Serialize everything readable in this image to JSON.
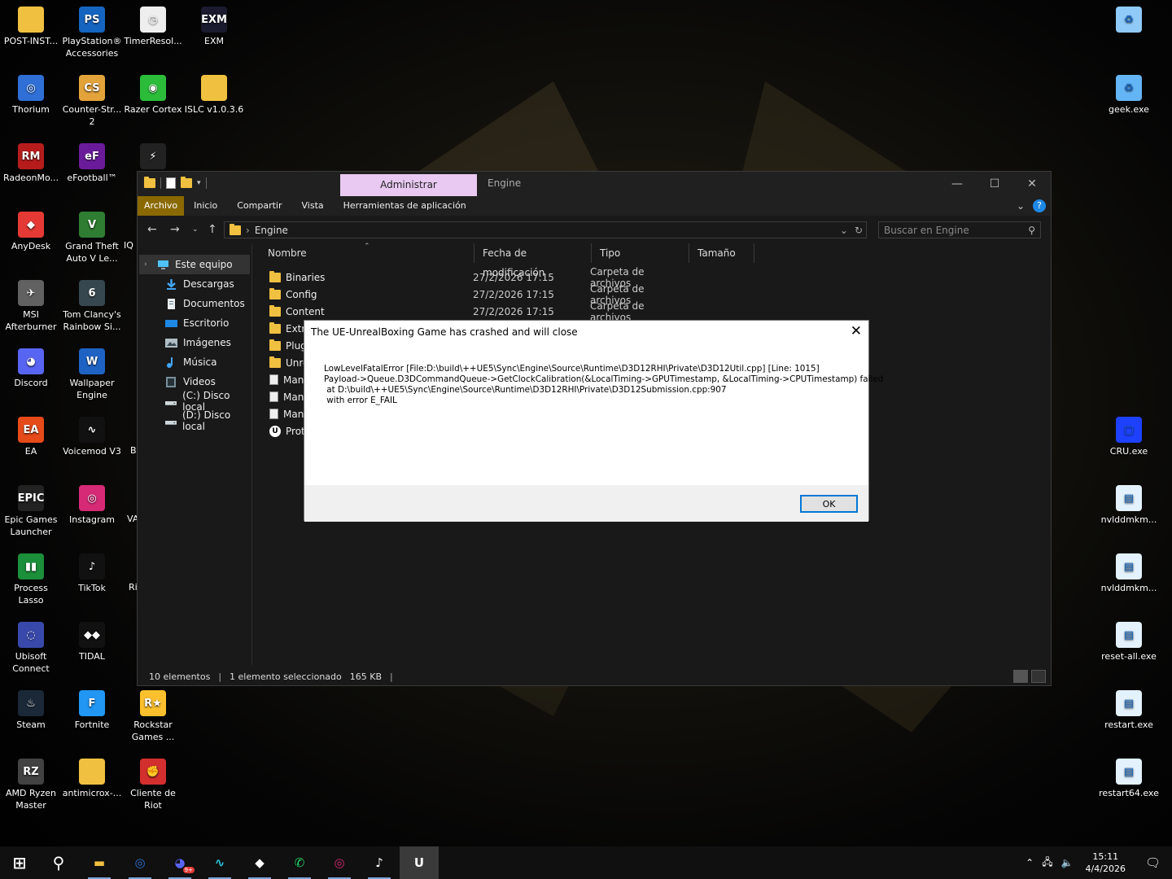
{
  "desktop": {
    "icons_left": [
      {
        "id": "post-install",
        "label": "POST-INST...",
        "glyph": "",
        "color": "#f0c040"
      },
      {
        "id": "playstation",
        "label": "PlayStation® Accessories",
        "glyph": "PS",
        "color": "#1565c0"
      },
      {
        "id": "timerresol",
        "label": "TimerResol...",
        "glyph": "◷",
        "color": "#eeeeee"
      },
      {
        "id": "exm",
        "label": "EXM",
        "glyph": "EXM",
        "color": "#1b1b2f"
      },
      {
        "id": "thorium",
        "label": "Thorium",
        "glyph": "◎",
        "color": "#2f6fd6"
      },
      {
        "id": "counter-strike",
        "label": "Counter-Str... 2",
        "glyph": "CS",
        "color": "#e3a33b"
      },
      {
        "id": "razer-cortex",
        "label": "Razer Cortex",
        "glyph": "◉",
        "color": "#2bbd3a"
      },
      {
        "id": "islc",
        "label": "ISLC v1.0.3.6",
        "glyph": "",
        "color": "#f0c040"
      },
      {
        "id": "radeon",
        "label": "RadeonMo...",
        "glyph": "RM",
        "color": "#b71c1c"
      },
      {
        "id": "efootball",
        "label": "eFootball™",
        "glyph": "eF",
        "color": "#6a1b9a"
      },
      {
        "id": "valorant-like",
        "label": "",
        "glyph": "⚡",
        "color": "#222222"
      },
      {
        "id": "anydesk",
        "label": "AnyDesk",
        "glyph": "◆",
        "color": "#e53935"
      },
      {
        "id": "gta",
        "label": "Grand Theft Auto V Le...",
        "glyph": "V",
        "color": "#2e7d32"
      },
      {
        "id": "msi-afterburner",
        "label": "MSI Afterburner",
        "glyph": "✈",
        "color": "#616161"
      },
      {
        "id": "rainbow-six",
        "label": "Tom Clancy's Rainbow Si...",
        "glyph": "6",
        "color": "#37474f"
      },
      {
        "id": "discord",
        "label": "Discord",
        "glyph": "◕",
        "color": "#5865f2"
      },
      {
        "id": "wallpaper-engine",
        "label": "Wallpaper Engine",
        "glyph": "W",
        "color": "#1e63c4"
      },
      {
        "id": "ea",
        "label": "EA",
        "glyph": "EA",
        "color": "#e64a19"
      },
      {
        "id": "voicemod",
        "label": "Voicemod V3",
        "glyph": "∿",
        "color": "#111111"
      },
      {
        "id": "epic-games",
        "label": "Epic Games Launcher",
        "glyph": "EPIC",
        "color": "#222222"
      },
      {
        "id": "instagram",
        "label": "Instagram",
        "glyph": "◎",
        "color": "#d62976"
      },
      {
        "id": "process-lasso",
        "label": "Process Lasso",
        "glyph": "▮▮",
        "color": "#1b8f3a"
      },
      {
        "id": "tiktok",
        "label": "TikTok",
        "glyph": "♪",
        "color": "#111111"
      },
      {
        "id": "ubisoft",
        "label": "Ubisoft Connect",
        "glyph": "◌",
        "color": "#3949ab"
      },
      {
        "id": "tidal",
        "label": "TIDAL",
        "glyph": "◆◆",
        "color": "#111111"
      },
      {
        "id": "steam",
        "label": "Steam",
        "glyph": "♨",
        "color": "#1b2838"
      },
      {
        "id": "fortnite",
        "label": "Fortnite",
        "glyph": "F",
        "color": "#2196f3"
      },
      {
        "id": "rockstar",
        "label": "Rockstar Games ...",
        "glyph": "R★",
        "color": "#fbc02d"
      },
      {
        "id": "ryzen-master",
        "label": "AMD Ryzen Master",
        "glyph": "RZ",
        "color": "#424242"
      },
      {
        "id": "antimicrox",
        "label": "antimicrox-...",
        "glyph": "",
        "color": "#f0c040"
      },
      {
        "id": "riot",
        "label": "Cliente de Riot",
        "glyph": "✊",
        "color": "#d32f2f"
      }
    ],
    "partial_labels": [
      {
        "id": "iq",
        "label": "IQ"
      },
      {
        "id": "b",
        "label": "B"
      },
      {
        "id": "va",
        "label": "VA"
      },
      {
        "id": "ri",
        "label": "Ri"
      }
    ],
    "icons_right": [
      {
        "id": "recycle-bin",
        "label": "",
        "glyph": "♻",
        "color": "#90caf9"
      },
      {
        "id": "geek",
        "label": "geek.exe",
        "glyph": "♻",
        "color": "#64b5f6"
      },
      {
        "id": "cru",
        "label": "CRU.exe",
        "glyph": "▢",
        "color": "#1e40ff"
      },
      {
        "id": "nvlddmkm1",
        "label": "nvlddmkm...",
        "glyph": "▤",
        "color": "#e3f2fd"
      },
      {
        "id": "nvlddmkm2",
        "label": "nvlddmkm...",
        "glyph": "▤",
        "color": "#e3f2fd"
      },
      {
        "id": "reset-all",
        "label": "reset-all.exe",
        "glyph": "▤",
        "color": "#e3f2fd"
      },
      {
        "id": "restart",
        "label": "restart.exe",
        "glyph": "▤",
        "color": "#e3f2fd"
      },
      {
        "id": "restart64",
        "label": "restart64.exe",
        "glyph": "▤",
        "color": "#e3f2fd"
      }
    ]
  },
  "explorer": {
    "context_tab": "Administrar",
    "window_title": "Engine",
    "ribbon_tabs": [
      "Archivo",
      "Inicio",
      "Compartir",
      "Vista",
      "Herramientas de aplicación"
    ],
    "address": "Engine",
    "search_placeholder": "Buscar en Engine",
    "nav": [
      {
        "id": "este-equipo",
        "label": "Este equipo",
        "icon": "computer-icon"
      },
      {
        "id": "descargas",
        "label": "Descargas",
        "icon": "download-icon"
      },
      {
        "id": "documentos",
        "label": "Documentos",
        "icon": "document-icon"
      },
      {
        "id": "escritorio",
        "label": "Escritorio",
        "icon": "desktop-icon"
      },
      {
        "id": "imagenes",
        "label": "Imágenes",
        "icon": "image-icon"
      },
      {
        "id": "musica",
        "label": "Música",
        "icon": "music-icon"
      },
      {
        "id": "videos",
        "label": "Videos",
        "icon": "video-icon"
      },
      {
        "id": "disco-c",
        "label": "(C:) Disco local",
        "icon": "drive-icon"
      },
      {
        "id": "disco-d",
        "label": "(D:) Disco local",
        "icon": "drive-icon"
      }
    ],
    "columns": [
      "Nombre",
      "Fecha de modificación",
      "Tipo",
      "Tamaño"
    ],
    "files": [
      {
        "name": "Binaries",
        "date": "27/2/2026 17:15",
        "type": "Carpeta de archivos",
        "kind": "folder"
      },
      {
        "name": "Config",
        "date": "27/2/2026 17:15",
        "type": "Carpeta de archivos",
        "kind": "folder"
      },
      {
        "name": "Content",
        "date": "27/2/2026 17:15",
        "type": "Carpeta de archivos",
        "kind": "folder"
      },
      {
        "name": "Extra",
        "date": "",
        "type": "",
        "kind": "folder"
      },
      {
        "name": "Plug",
        "date": "",
        "type": "",
        "kind": "folder"
      },
      {
        "name": "Unre",
        "date": "",
        "type": "",
        "kind": "folder"
      },
      {
        "name": "Man",
        "date": "",
        "type": "",
        "kind": "file"
      },
      {
        "name": "Man",
        "date": "",
        "type": "",
        "kind": "file"
      },
      {
        "name": "Man",
        "date": "",
        "type": "",
        "kind": "file"
      },
      {
        "name": "Prot",
        "date": "",
        "type": "",
        "kind": "ue"
      }
    ],
    "status": {
      "count": "10 elementos",
      "selected": "1 elemento seleccionado",
      "size": "165 KB"
    }
  },
  "dialog": {
    "title": "The UE-UnrealBoxing Game has crashed and will close",
    "lines": [
      "LowLevelFatalError [File:D:\\build\\++UE5\\Sync\\Engine\\Source\\Runtime\\D3D12RHI\\Private\\D3D12Util.cpp] [Line: 1015]",
      "Payload->Queue.D3DCommandQueue->GetClockCalibration(&LocalTiming->GPUTimestamp, &LocalTiming->CPUTimestamp) failed",
      " at D:\\build\\++UE5\\Sync\\Engine\\Source\\Runtime\\D3D12RHI\\Private\\D3D12Submission.cpp:907",
      " with error E_FAIL"
    ],
    "ok_label": "OK"
  },
  "taskbar": {
    "apps": [
      {
        "id": "start",
        "glyph": "⊞",
        "color": "#ffffff",
        "state": ""
      },
      {
        "id": "search",
        "glyph": "⚲",
        "color": "#ffffff",
        "state": ""
      },
      {
        "id": "explorer",
        "glyph": "▬",
        "color": "#f0c040",
        "state": "running"
      },
      {
        "id": "thorium",
        "glyph": "◎",
        "color": "#2f6fd6",
        "state": "running"
      },
      {
        "id": "discord",
        "glyph": "◕",
        "color": "#5865f2",
        "state": "running",
        "badge": "9+"
      },
      {
        "id": "voicemod",
        "glyph": "∿",
        "color": "#26c6da",
        "state": "running"
      },
      {
        "id": "tidal",
        "glyph": "◆",
        "color": "#ffffff",
        "state": "running"
      },
      {
        "id": "whatsapp",
        "glyph": "✆",
        "color": "#25d366",
        "state": "running"
      },
      {
        "id": "instagram",
        "glyph": "◎",
        "color": "#d62976",
        "state": "running"
      },
      {
        "id": "tiktok",
        "glyph": "♪",
        "color": "#ffffff",
        "state": "running"
      },
      {
        "id": "unreal",
        "glyph": "U",
        "color": "#ffffff",
        "state": "active"
      }
    ],
    "time": "15:11",
    "date": "4/4/2026"
  }
}
